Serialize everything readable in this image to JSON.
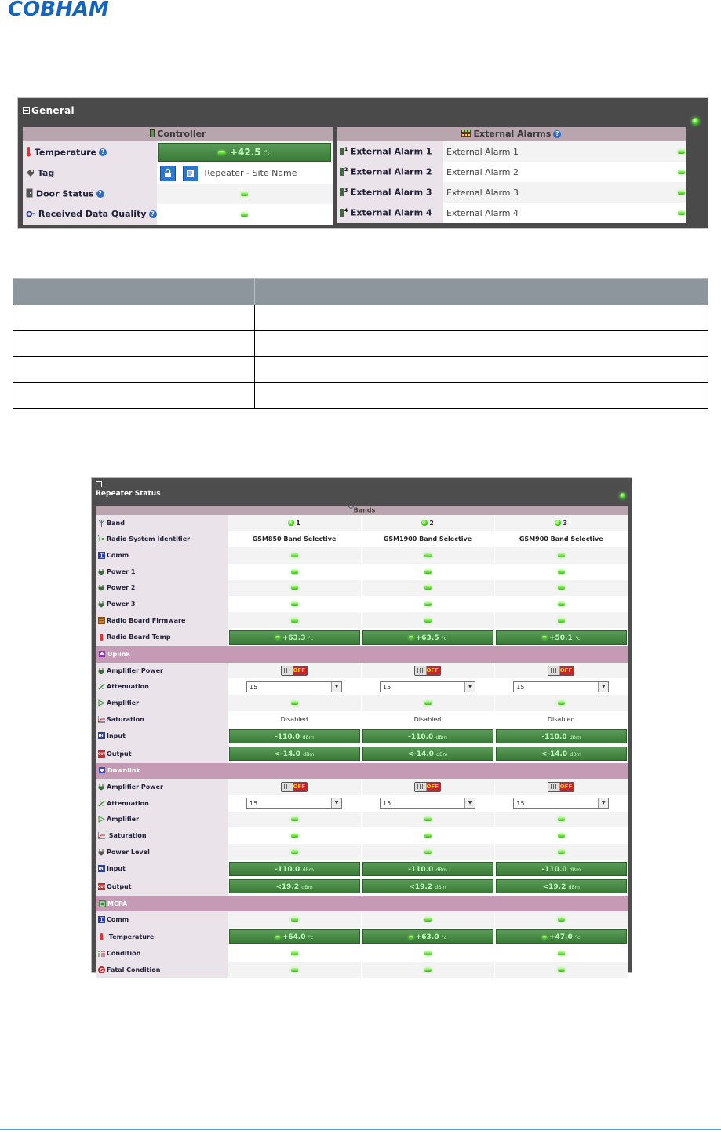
{
  "logo": {
    "text": "COBHAM",
    "color": "#1565c0"
  },
  "general": {
    "title": "General",
    "controller": {
      "header": "Controller",
      "rows": [
        {
          "label": "Temperature",
          "value": "+42.5",
          "unit": "°c"
        },
        {
          "label": "Tag",
          "value": "Repeater - Site Name"
        },
        {
          "label": "Door Status"
        },
        {
          "label": "Received Data Quality"
        }
      ]
    },
    "external_alarms": {
      "header": "External Alarms",
      "rows": [
        {
          "label": "External Alarm 1",
          "value": "External Alarm 1"
        },
        {
          "label": "External Alarm 2",
          "value": "External Alarm 2"
        },
        {
          "label": "External Alarm 3",
          "value": "External Alarm 3"
        },
        {
          "label": "External Alarm 4",
          "value": "External Alarm 4"
        }
      ]
    }
  },
  "repeater": {
    "title": "Repeater Status",
    "bands_header": "Bands",
    "band_label": "Band",
    "bands": [
      "1",
      "2",
      "3"
    ],
    "rsi_label": "Radio System Identifier",
    "rsi": [
      "GSM850 Band Selective",
      "GSM1900 Band Selective",
      "GSM900 Band Selective"
    ],
    "status_rows": [
      "Comm",
      "Power 1",
      "Power 2",
      "Power 3",
      "Radio Board Firmware"
    ],
    "radio_temp_label": "Radio Board Temp",
    "radio_temp": [
      "+63.3",
      "+63.5",
      "+50.1"
    ],
    "temp_unit": "°c",
    "uplink": {
      "title": "Uplink",
      "amp_power": "Amplifier Power",
      "off_text": "OFF",
      "attenuation": "Attenuation",
      "att_values": [
        "15",
        "15",
        "15"
      ],
      "amplifier": "Amplifier",
      "saturation": "Saturation",
      "saturation_values": [
        "Disabled",
        "Disabled",
        "Disabled"
      ],
      "input": "Input",
      "input_values": [
        "-110.0",
        "-110.0",
        "-110.0"
      ],
      "output": "Output",
      "output_values": [
        "<-14.0",
        "<-14.0",
        "<-14.0"
      ],
      "dbm": "dBm"
    },
    "downlink": {
      "title": "Downlink",
      "amp_power": "Amplifier Power",
      "attenuation": "Attenuation",
      "att_values": [
        "15",
        "15",
        "15"
      ],
      "amplifier": "Amplifier",
      "saturation": "Saturation",
      "power_level": "Power Level",
      "input": "Input",
      "input_values": [
        "-110.0",
        "-110.0",
        "-110.0"
      ],
      "output": "Output",
      "output_values": [
        "<19.2",
        "<19.2",
        "<19.2"
      ]
    },
    "mcpa": {
      "title": "MCPA",
      "comm": "Comm",
      "temperature": "Temperature",
      "temp_values": [
        "+64.0",
        "+63.0",
        "+47.0"
      ],
      "condition": "Condition",
      "fatal": "Fatal Condition"
    }
  }
}
